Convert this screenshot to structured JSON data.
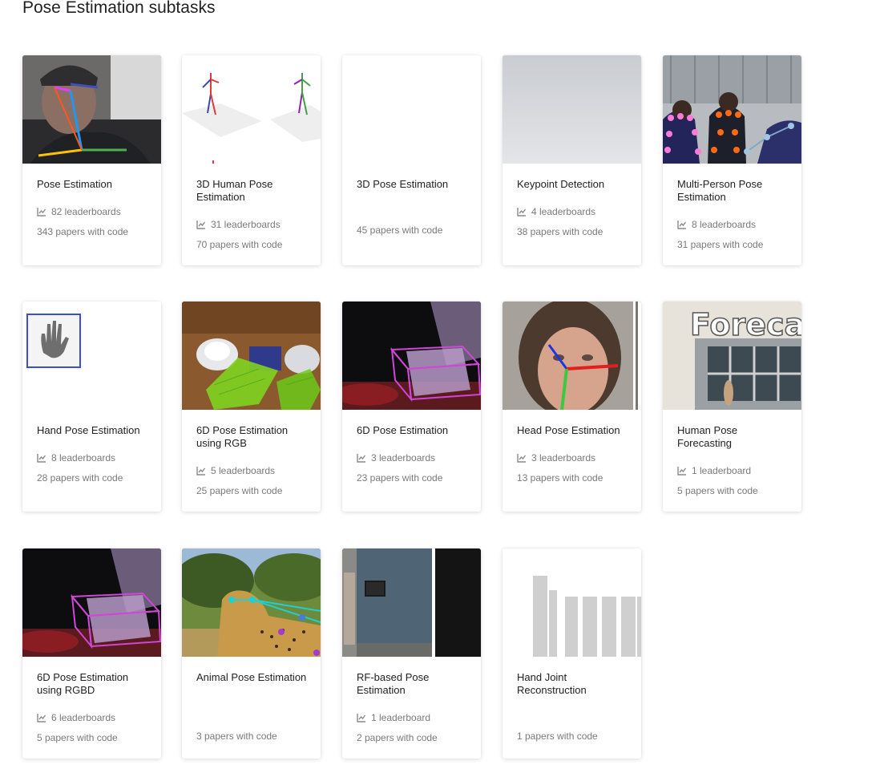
{
  "section": {
    "title": "Pose Estimation subtasks"
  },
  "cards": [
    {
      "title": "Pose Estimation",
      "leaderboards": "82 leaderboards",
      "papers": "343 papers with code"
    },
    {
      "title": "3D Human Pose Estimation",
      "leaderboards": "31 leaderboards",
      "papers": "70 papers with code"
    },
    {
      "title": "3D Pose Estimation",
      "leaderboards": "",
      "papers": "45 papers with code"
    },
    {
      "title": "Keypoint Detection",
      "leaderboards": "4 leaderboards",
      "papers": "38 papers with code"
    },
    {
      "title": "Multi-Person Pose Estimation",
      "leaderboards": "8 leaderboards",
      "papers": "31 papers with code"
    },
    {
      "title": "Hand Pose Estimation",
      "leaderboards": "8 leaderboards",
      "papers": "28 papers with code"
    },
    {
      "title": "6D Pose Estimation using RGB",
      "leaderboards": "5 leaderboards",
      "papers": "25 papers with code"
    },
    {
      "title": "6D Pose Estimation",
      "leaderboards": "3 leaderboards",
      "papers": "23 papers with code"
    },
    {
      "title": "Head Pose Estimation",
      "leaderboards": "3 leaderboards",
      "papers": "13 papers with code"
    },
    {
      "title": "Human Pose Forecasting",
      "leaderboards": "1 leaderboard",
      "papers": "5 papers with code",
      "thumb_text": "Foreca"
    },
    {
      "title": "6D Pose Estimation using RGBD",
      "leaderboards": "6 leaderboards",
      "papers": "5 papers with code"
    },
    {
      "title": "Animal Pose Estimation",
      "leaderboards": "",
      "papers": "3 papers with code"
    },
    {
      "title": "RF-based Pose Estimation",
      "leaderboards": "1 leaderboard",
      "papers": "2 papers with code"
    },
    {
      "title": "Hand Joint Reconstruction",
      "leaderboards": "",
      "papers": "1 papers with code"
    }
  ],
  "icons": {
    "leaderboard": "chart-line-icon"
  },
  "colors": {
    "text": "#222222",
    "muted": "#7a7a7a",
    "card_bg": "#ffffff"
  }
}
